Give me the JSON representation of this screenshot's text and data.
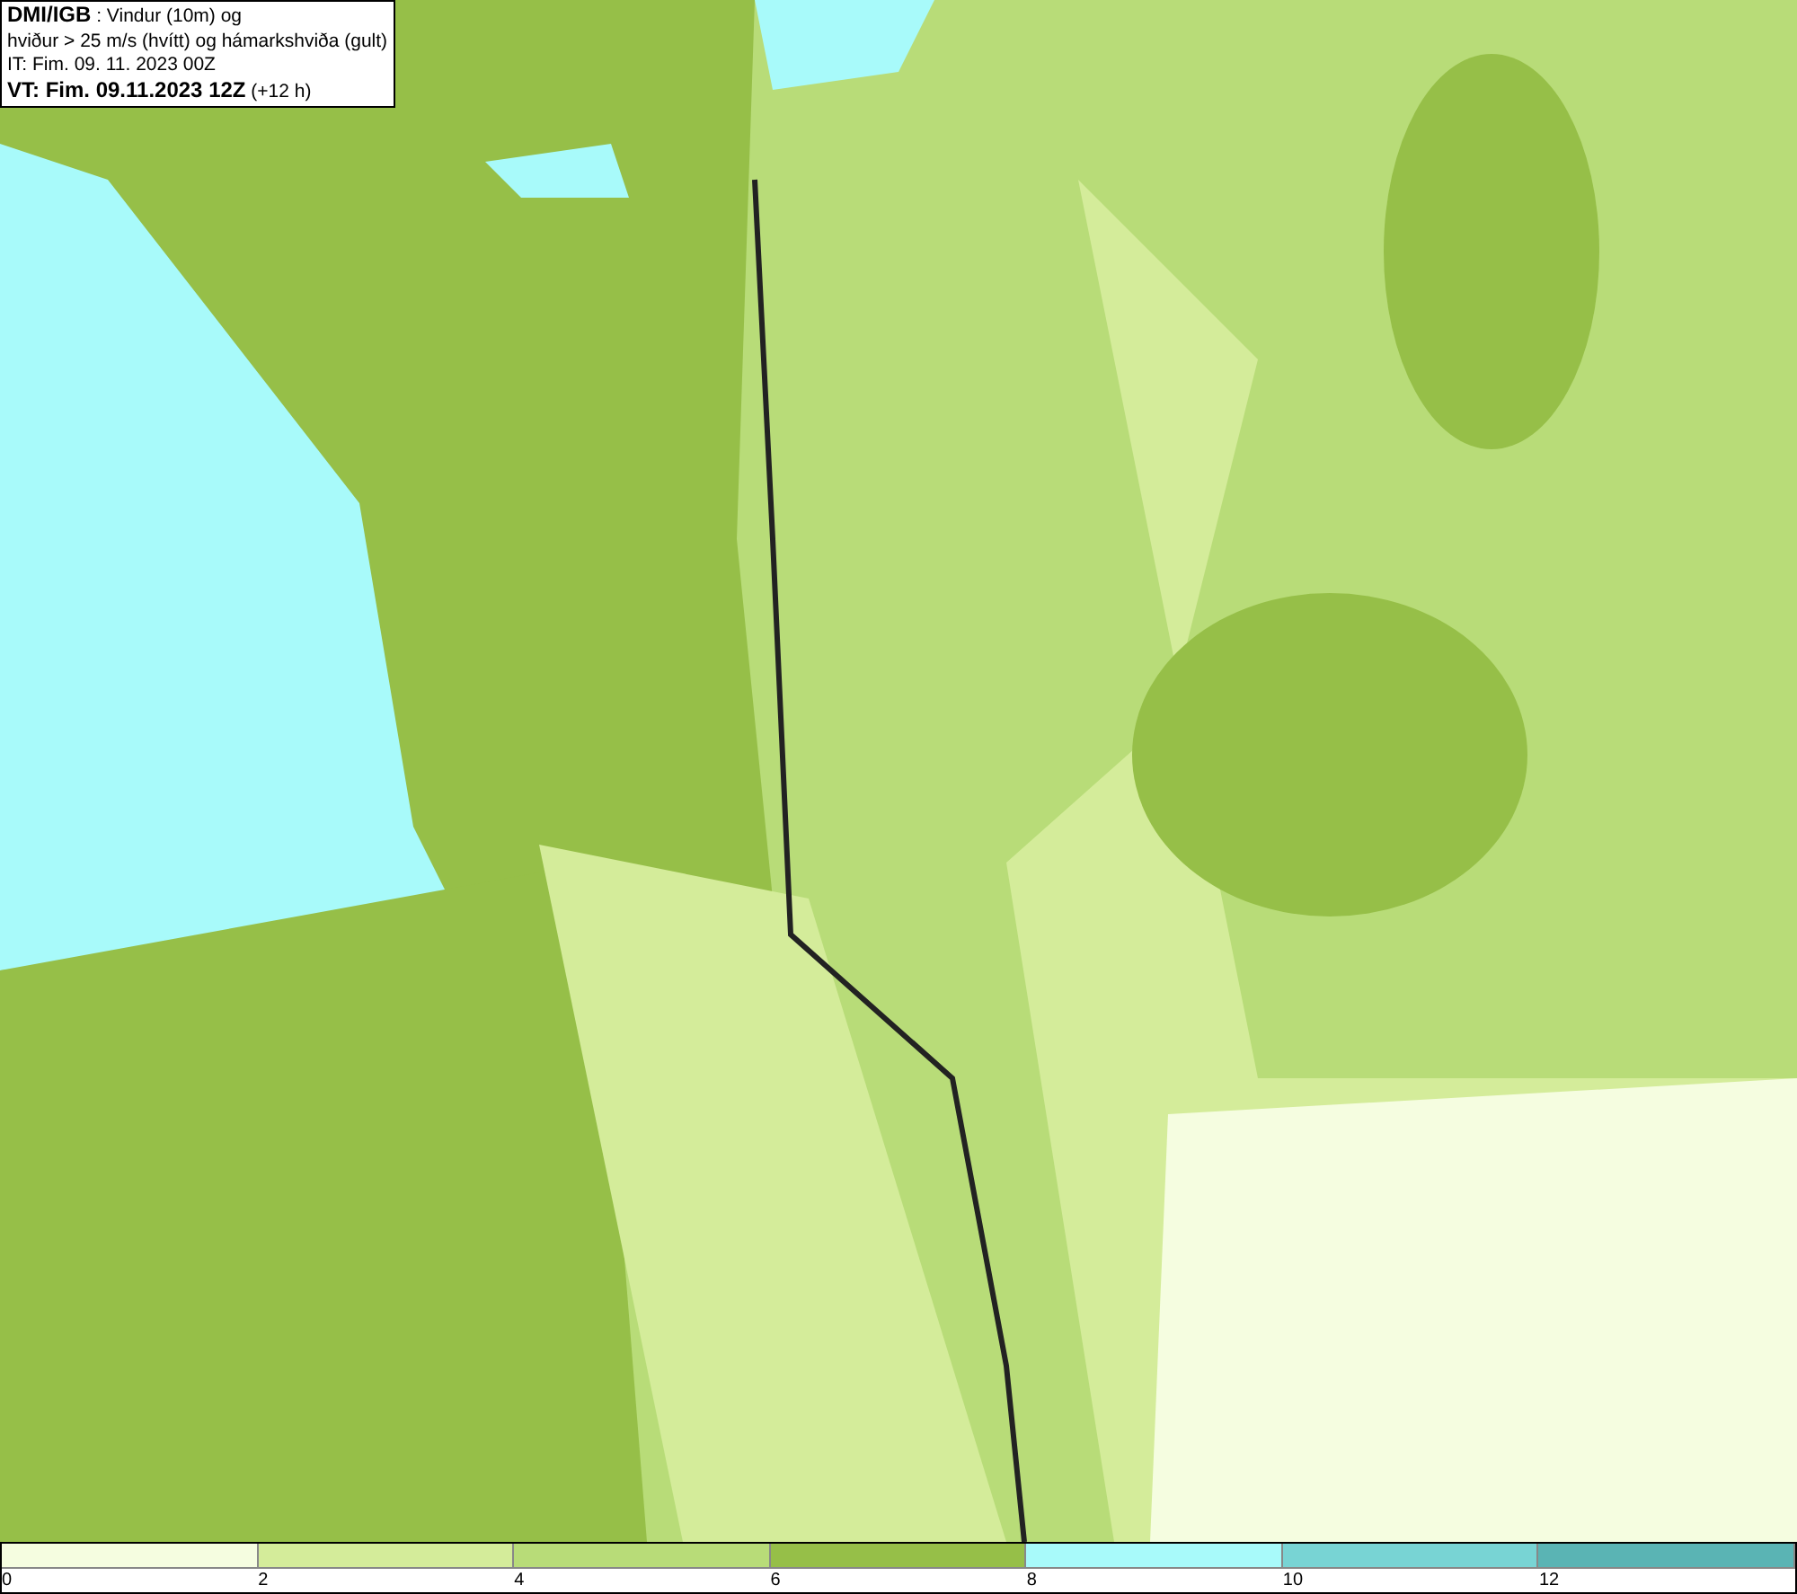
{
  "title_box": {
    "lines": [
      "**DMI/IGB** : Vindur (10m) og",
      "hviður > 25 m/s (hvítt) og hámarkshviða (gult)",
      "IT: Fim. 09. 11. 2023 00Z",
      "**VT: Fim. 09.11.2023 12Z** (+12 h)"
    ]
  },
  "legend": [
    {
      "label": "0",
      "color": "#f5fde0"
    },
    {
      "label": "2",
      "color": "#d4ec9a"
    },
    {
      "label": "4",
      "color": "#b8dc78"
    },
    {
      "label": "6",
      "color": "#96bf48"
    },
    {
      "label": "8",
      "color": "#a8fafa"
    },
    {
      "label": "10",
      "color": "#78d4d4"
    },
    {
      "label": "12",
      "color": "#5ab4b4"
    }
  ]
}
